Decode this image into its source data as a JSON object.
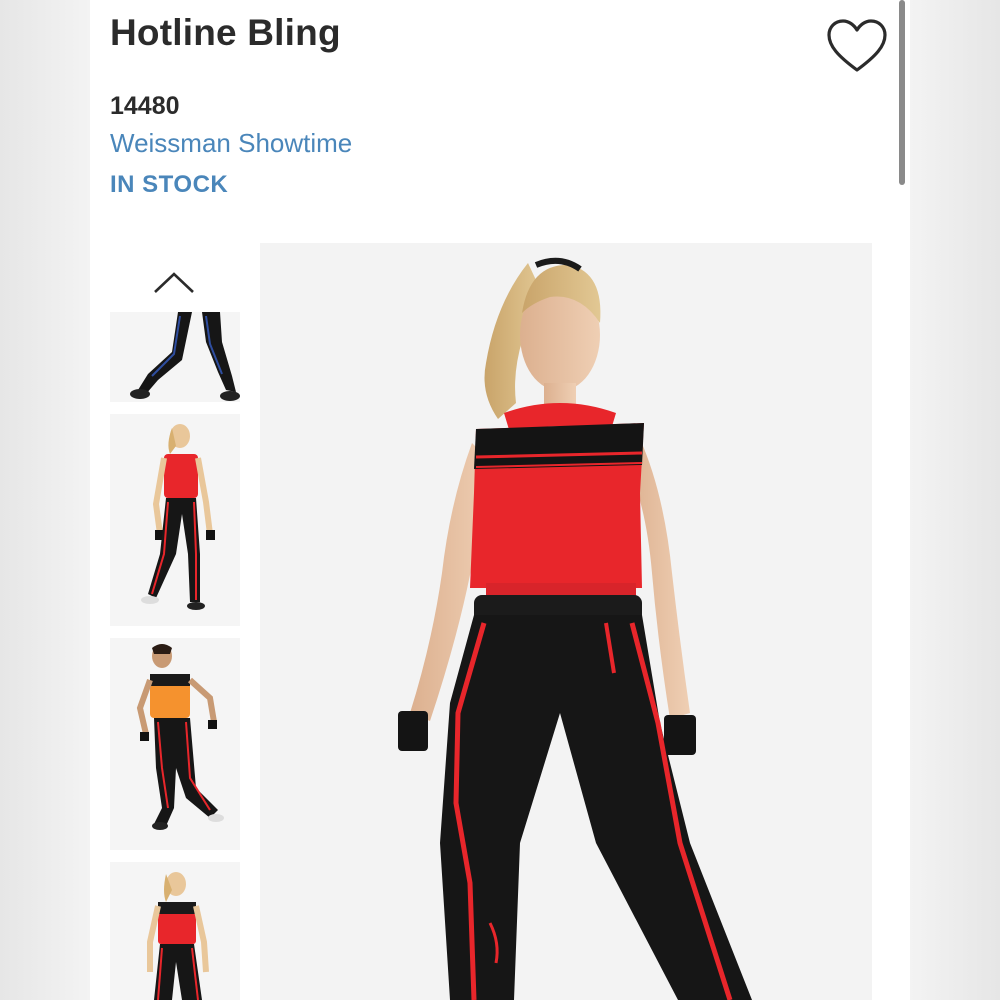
{
  "product": {
    "title": "Hotline Bling",
    "sku": "14480",
    "brand": "Weissman Showtime",
    "stock_status": "IN STOCK"
  },
  "icons": {
    "favorite": "heart-outline-icon",
    "gallery_up": "chevron-up-icon"
  },
  "colors": {
    "link_blue": "#4a86ba",
    "title_dark": "#2b2b2b",
    "costume_red": "#e8262b",
    "costume_orange": "#f5922e",
    "pants_black": "#161616"
  },
  "gallery": {
    "thumbnails": [
      {
        "name": "thumb-legs-view",
        "top_color": "#1a1a1a",
        "stripe": "#2f4ea0"
      },
      {
        "name": "thumb-back-view",
        "top_color": "#e8262b",
        "stripe": "#e8262b"
      },
      {
        "name": "thumb-orange-variant",
        "top_color": "#f5922e",
        "stripe": "#e8262b"
      },
      {
        "name": "thumb-front-view",
        "top_color": "#e8262b",
        "stripe": "#e8262b"
      }
    ]
  }
}
